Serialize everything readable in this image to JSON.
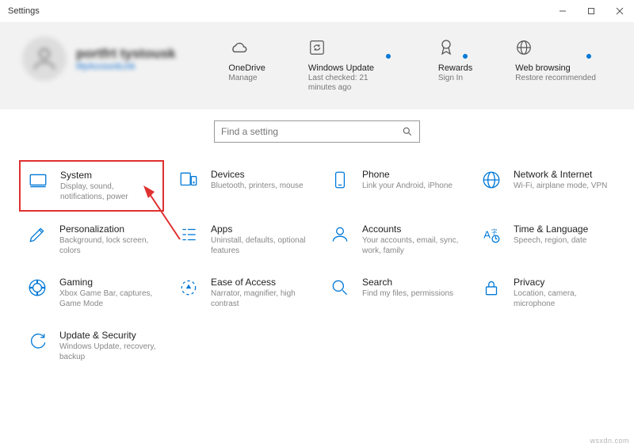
{
  "window": {
    "title": "Settings"
  },
  "profile": {
    "name": "portfrt tystousk",
    "link": "MyAccountLink"
  },
  "status": {
    "onedrive": {
      "title": "OneDrive",
      "sub": "Manage"
    },
    "update": {
      "title": "Windows Update",
      "sub": "Last checked: 21 minutes ago"
    },
    "rewards": {
      "title": "Rewards",
      "sub": "Sign In"
    },
    "web": {
      "title": "Web browsing",
      "sub": "Restore recommended"
    }
  },
  "search": {
    "placeholder": "Find a setting"
  },
  "categories": [
    {
      "id": "system",
      "title": "System",
      "desc": "Display, sound, notifications, power",
      "highlight": true
    },
    {
      "id": "devices",
      "title": "Devices",
      "desc": "Bluetooth, printers, mouse"
    },
    {
      "id": "phone",
      "title": "Phone",
      "desc": "Link your Android, iPhone"
    },
    {
      "id": "network",
      "title": "Network & Internet",
      "desc": "Wi-Fi, airplane mode, VPN"
    },
    {
      "id": "personalization",
      "title": "Personalization",
      "desc": "Background, lock screen, colors"
    },
    {
      "id": "apps",
      "title": "Apps",
      "desc": "Uninstall, defaults, optional features"
    },
    {
      "id": "accounts",
      "title": "Accounts",
      "desc": "Your accounts, email, sync, work, family"
    },
    {
      "id": "time",
      "title": "Time & Language",
      "desc": "Speech, region, date"
    },
    {
      "id": "gaming",
      "title": "Gaming",
      "desc": "Xbox Game Bar, captures, Game Mode"
    },
    {
      "id": "ease",
      "title": "Ease of Access",
      "desc": "Narrator, magnifier, high contrast"
    },
    {
      "id": "search-cat",
      "title": "Search",
      "desc": "Find my files, permissions"
    },
    {
      "id": "privacy",
      "title": "Privacy",
      "desc": "Location, camera, microphone"
    },
    {
      "id": "update-sec",
      "title": "Update & Security",
      "desc": "Windows Update, recovery, backup"
    }
  ],
  "watermark": "wsxdn.com"
}
